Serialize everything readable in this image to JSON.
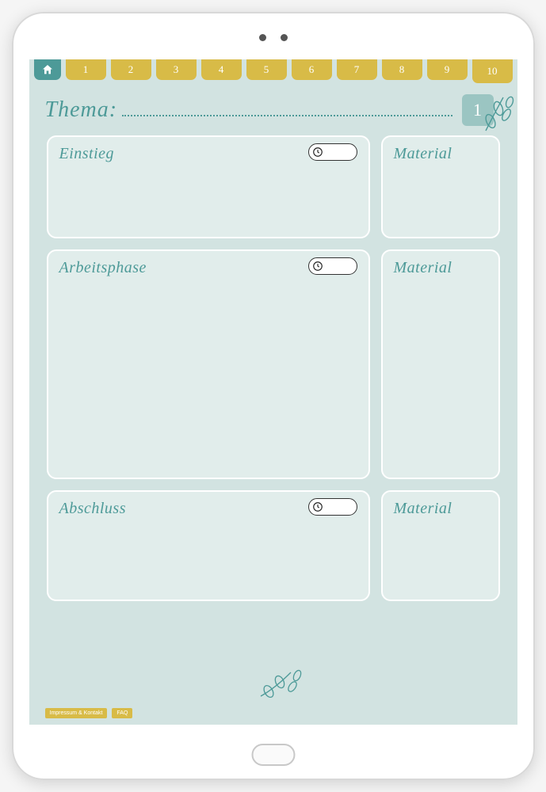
{
  "tabs": [
    "1",
    "2",
    "3",
    "4",
    "5",
    "6",
    "7",
    "8",
    "9",
    "10"
  ],
  "active_tab_index": 9,
  "thema_label": "Thema:",
  "page_number": "1",
  "sections": {
    "einstieg": {
      "title": "Einstieg",
      "material": "Material"
    },
    "arbeitsphase": {
      "title": "Arbeitsphase",
      "material": "Material"
    },
    "abschluss": {
      "title": "Abschluss",
      "material": "Material"
    }
  },
  "footer": {
    "impressum": "Impressum & Kontakt",
    "faq": "FAQ"
  }
}
